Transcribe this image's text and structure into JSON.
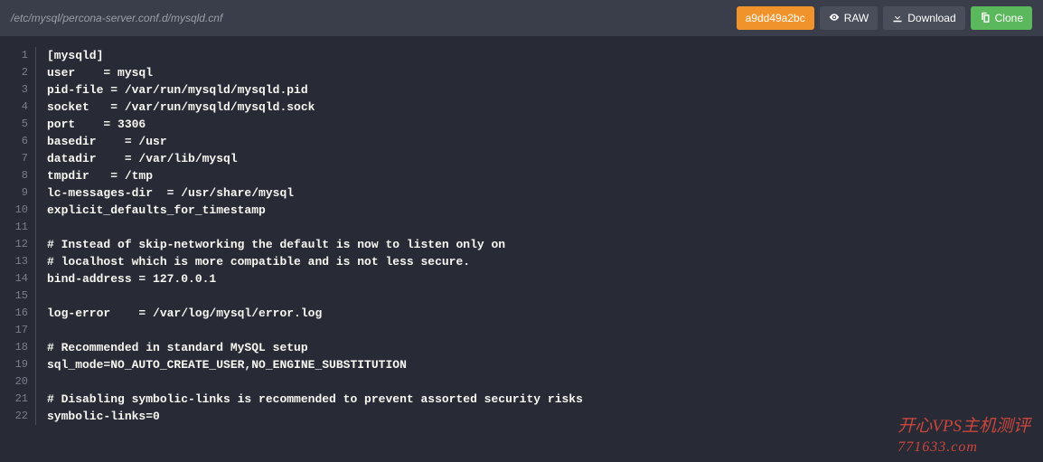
{
  "toolbar": {
    "filepath": "/etc/mysql/percona-server.conf.d/mysqld.cnf",
    "commit": "a9dd49a2bc",
    "raw": "RAW",
    "download": "Download",
    "clone": "Clone"
  },
  "code": {
    "lines": [
      "[mysqld]",
      "user    = mysql",
      "pid-file = /var/run/mysqld/mysqld.pid",
      "socket   = /var/run/mysqld/mysqld.sock",
      "port    = 3306",
      "basedir    = /usr",
      "datadir    = /var/lib/mysql",
      "tmpdir   = /tmp",
      "lc-messages-dir  = /usr/share/mysql",
      "explicit_defaults_for_timestamp",
      "",
      "# Instead of skip-networking the default is now to listen only on",
      "# localhost which is more compatible and is not less secure.",
      "bind-address = 127.0.0.1",
      "",
      "log-error    = /var/log/mysql/error.log",
      "",
      "# Recommended in standard MySQL setup",
      "sql_mode=NO_AUTO_CREATE_USER,NO_ENGINE_SUBSTITUTION",
      "",
      "# Disabling symbolic-links is recommended to prevent assorted security risks",
      "symbolic-links=0"
    ]
  },
  "watermark": {
    "main": "开心VPS主机测评",
    "sub": "771633.com"
  }
}
